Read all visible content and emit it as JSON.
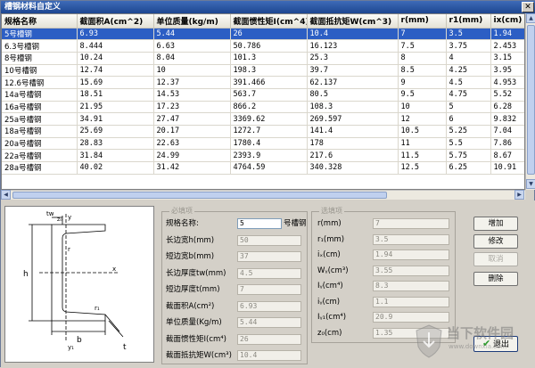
{
  "window": {
    "title": "槽钢材料自定义",
    "close_glyph": "✕"
  },
  "table": {
    "columns": [
      "规格名称",
      "截面积A(cm^2)",
      "单位质量(kg/m)",
      "截面惯性矩I(cm^4)",
      "截面抵抗矩W(cm^3)",
      "r(mm)",
      "r1(mm)",
      "ix(cm)"
    ],
    "rows": [
      [
        "5号槽钢",
        "6.93",
        "5.44",
        "26",
        "10.4",
        "7",
        "3.5",
        "1.94"
      ],
      [
        "6.3号槽钢",
        "8.444",
        "6.63",
        "50.786",
        "16.123",
        "7.5",
        "3.75",
        "2.453"
      ],
      [
        "8号槽钢",
        "10.24",
        "8.04",
        "101.3",
        "25.3",
        "8",
        "4",
        "3.15"
      ],
      [
        "10号槽钢",
        "12.74",
        "10",
        "198.3",
        "39.7",
        "8.5",
        "4.25",
        "3.95"
      ],
      [
        "12.6号槽钢",
        "15.69",
        "12.37",
        "391.466",
        "62.137",
        "9",
        "4.5",
        "4.953"
      ],
      [
        "14a号槽钢",
        "18.51",
        "14.53",
        "563.7",
        "80.5",
        "9.5",
        "4.75",
        "5.52"
      ],
      [
        "16a号槽钢",
        "21.95",
        "17.23",
        "866.2",
        "108.3",
        "10",
        "5",
        "6.28"
      ],
      [
        "25a号槽钢",
        "34.91",
        "27.47",
        "3369.62",
        "269.597",
        "12",
        "6",
        "9.832"
      ],
      [
        "18a号槽钢",
        "25.69",
        "20.17",
        "1272.7",
        "141.4",
        "10.5",
        "5.25",
        "7.04"
      ],
      [
        "20a号槽钢",
        "28.83",
        "22.63",
        "1780.4",
        "178",
        "11",
        "5.5",
        "7.86"
      ],
      [
        "22a号槽钢",
        "31.84",
        "24.99",
        "2393.9",
        "217.6",
        "11.5",
        "5.75",
        "8.67"
      ],
      [
        "28a号槽钢",
        "40.02",
        "31.42",
        "4764.59",
        "340.328",
        "12.5",
        "6.25",
        "10.91"
      ]
    ]
  },
  "scroll": {
    "up": "▲",
    "down": "▼",
    "left": "◀",
    "right": "▶"
  },
  "required_group": {
    "title": "必填项",
    "fields": [
      {
        "label": "规格名称:",
        "value": "5",
        "suffix": "号槽钢"
      },
      {
        "label": "长边宽h(mm)",
        "value": "50"
      },
      {
        "label": "短边宽b(mm)",
        "value": "37"
      },
      {
        "label": "长边厚度tw(mm)",
        "value": "4.5"
      },
      {
        "label": "短边厚度t(mm)",
        "value": "7"
      },
      {
        "label": "截面积A(cm²)",
        "value": "6.93"
      },
      {
        "label": "单位质量(Kg/m)",
        "value": "5.44"
      },
      {
        "label": "截面惯性矩I(cm⁴)",
        "value": "26"
      },
      {
        "label": "截面抵抗矩W(cm³)",
        "value": "10.4"
      }
    ]
  },
  "optional_group": {
    "title": "选填项",
    "fields": [
      {
        "label": "r(mm)",
        "value": "7"
      },
      {
        "label": "r₁(mm)",
        "value": "3.5"
      },
      {
        "label": "iₓ(cm)",
        "value": "1.94"
      },
      {
        "label": "Wᵧ(cm³)",
        "value": "3.55"
      },
      {
        "label": "Iᵧ(cm⁴)",
        "value": "8.3"
      },
      {
        "label": "iᵧ(cm)",
        "value": "1.1"
      },
      {
        "label": "Iᵧ₁(cm⁴)",
        "value": "20.9"
      },
      {
        "label": "z₀(cm)",
        "value": "1.35"
      }
    ]
  },
  "buttons": {
    "add": "增加",
    "edit": "修改",
    "cancel": "取消",
    "delete": "删除",
    "exit": "退出",
    "exit_check": "✔"
  },
  "diagram_labels": {
    "h": "h",
    "b": "b",
    "t": "t",
    "tw": "tw",
    "r": "r",
    "r1": "r₁",
    "x": "x",
    "y": "y",
    "z0": "z₀",
    "y1": "y₁"
  },
  "watermark": {
    "text": "当下软件园",
    "sub": "www.downxia.com"
  }
}
